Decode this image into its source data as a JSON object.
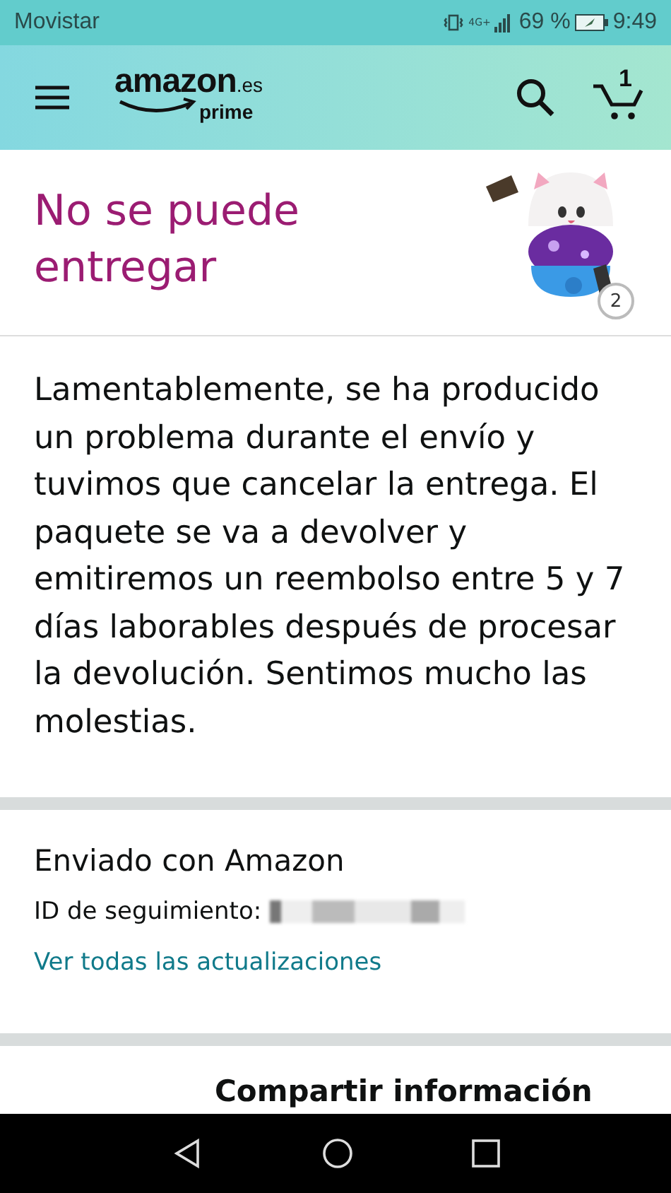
{
  "status_bar": {
    "carrier": "Movistar",
    "network": "4G+",
    "battery": "69 %",
    "time": "9:49"
  },
  "header": {
    "logo": {
      "word": "amazon",
      "domain": ".es",
      "program": "prime"
    },
    "cart_count": "1"
  },
  "order": {
    "title": "No se puede entregar",
    "product": {
      "kind": "picture",
      "quantity": "2"
    }
  },
  "message": "Lamentablemente, se ha producido un problema durante el envío y tuvimos que cancelar la entrega. El paquete se va a devolver y emitiremos un reembolso entre 5 y 7 días laborables después de procesar la devolución. Sentimos mucho las molestias.",
  "shipment": {
    "title": "Enviado con Amazon",
    "tracking_label": "ID de seguimiento:",
    "tracking_redacted": true,
    "link": "Ver todas las actualizaciones"
  },
  "next_section": {
    "title": "Compartir información"
  },
  "nav_bar": {
    "buttons": [
      {
        "kind": "back"
      },
      {
        "kind": "home"
      },
      {
        "kind": "recents"
      }
    ]
  }
}
